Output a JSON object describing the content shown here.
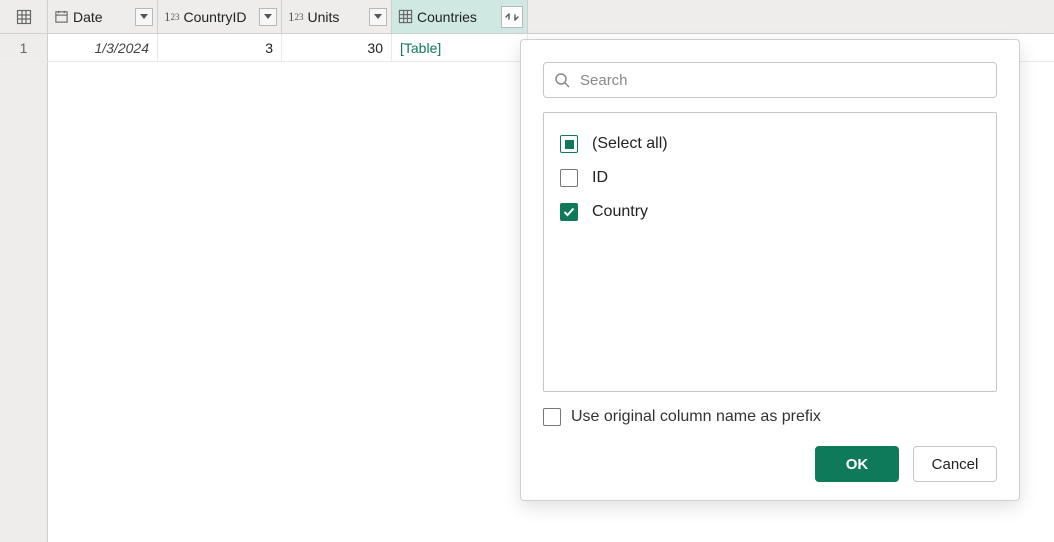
{
  "columns": {
    "date": {
      "label": "Date"
    },
    "countryId": {
      "label": "CountryID"
    },
    "units": {
      "label": "Units"
    },
    "countries": {
      "label": "Countries"
    }
  },
  "rows": [
    {
      "num": "1",
      "date": "1/3/2024",
      "countryId": "3",
      "units": "30",
      "countries": "[Table]"
    }
  ],
  "popup": {
    "search_placeholder": "Search",
    "options": {
      "select_all": {
        "label": "(Select all)"
      },
      "id": {
        "label": "ID"
      },
      "country": {
        "label": "Country"
      }
    },
    "prefix_label": "Use original column name as prefix",
    "ok_label": "OK",
    "cancel_label": "Cancel"
  }
}
